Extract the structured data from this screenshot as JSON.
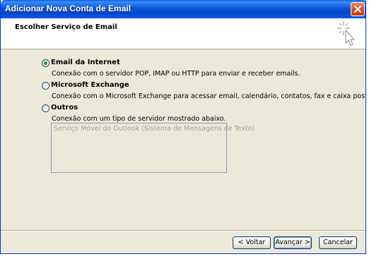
{
  "window": {
    "title": "Adicionar Nova Conta de Email",
    "close_icon": "close-icon",
    "title_bar_color": "#0a56d8"
  },
  "header": {
    "title": "Escolher Serviço de Email",
    "icon": "wizard-sparkle-cursor-icon"
  },
  "options": [
    {
      "label": "Email da Internet",
      "description": "Conexão com o servidor POP, IMAP ou HTTP para enviar e receber emails.",
      "selected": true
    },
    {
      "label": "Microsoft Exchange",
      "description": "Conexão com o Microsoft Exchange para acessar email, calendário, contatos, fax e caixa postal.",
      "selected": false
    },
    {
      "label": "Outros",
      "description": "Conexão com um tipo de servidor mostrado abaixo.",
      "selected": false
    }
  ],
  "server_list": {
    "items": [
      "Serviço Móvel do Outlook (Sistema de Mensagens de Texto)"
    ]
  },
  "buttons": {
    "back": "< Voltar",
    "next": "Avançar >",
    "cancel": "Cancelar"
  }
}
